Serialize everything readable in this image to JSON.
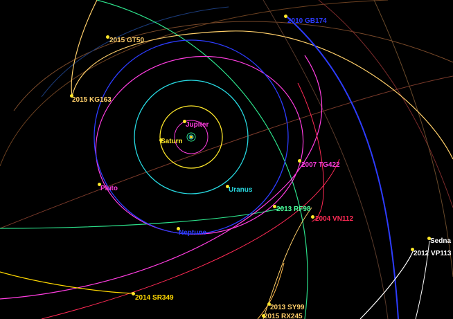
{
  "colors": {
    "background": "#000000",
    "sun": "#ffd21f",
    "jupiter": "#ff3de0",
    "saturn": "#ffe82a",
    "uranus": "#27d8e0",
    "neptune": "#2d3cff",
    "pluto": "#ff3de0",
    "dwarf_white": "#ffffff",
    "dwarf_yellow": "#ffc24a"
  },
  "bodies": {
    "jupiter": {
      "label": "Jupiter",
      "color": "#ff3de0"
    },
    "saturn": {
      "label": "Saturn",
      "color": "#ffe82a"
    },
    "uranus": {
      "label": "Uranus",
      "color": "#27d8e0"
    },
    "neptune": {
      "label": "Neptune",
      "color": "#2d3cff"
    },
    "pluto": {
      "label": "Pluto",
      "color": "#ff3de0"
    },
    "gb174": {
      "label": "2010 GB174",
      "color": "#2d3cff"
    },
    "gt50": {
      "label": "2015 GT50",
      "color": "#ffcf6a"
    },
    "kg163": {
      "label": "2015 KG163",
      "color": "#ffcf6a"
    },
    "tg422": {
      "label": "2007 TG422",
      "color": "#ff3de0"
    },
    "rf98": {
      "label": "2013 RF98",
      "color": "#4cff9a"
    },
    "vn112": {
      "label": "2004 VN112",
      "color": "#ff2a55"
    },
    "sedna": {
      "label": "Sedna",
      "color": "#ffffff"
    },
    "vp113": {
      "label": "2012 VP113",
      "color": "#ffffff"
    },
    "sr349": {
      "label": "2014 SR349",
      "color": "#ffd800"
    },
    "sy99": {
      "label": "2013 SY99",
      "color": "#ffcf6a"
    },
    "rx245": {
      "label": "2015 RX245",
      "color": "#ffcf6a"
    }
  }
}
